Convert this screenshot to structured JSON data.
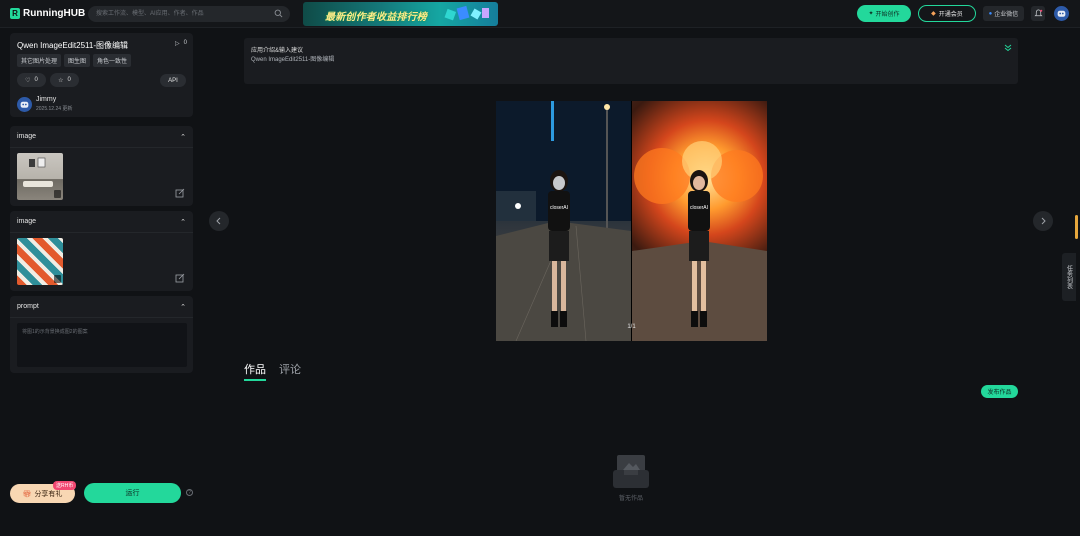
{
  "header": {
    "logo_mark": "R",
    "logo_text": "RunningHUB",
    "search_placeholder": "搜索工作流、模型、AI应用、作者、作品",
    "banner_text": "最新创作者收益排行榜",
    "create_label": "开始创作",
    "member_label": "开通会员",
    "enterprise_label": "企业微信"
  },
  "info": {
    "title": "Qwen ImageEdit2511-图像编辑",
    "runs": "0",
    "tags": [
      "其它图片处理",
      "图生图",
      "角色一致性"
    ],
    "likes": "0",
    "favorites": "0",
    "api_label": "API",
    "author": "Jimmy",
    "date": "2025.12.24 更新"
  },
  "inputs": {
    "image1_label": "image",
    "image2_label": "image",
    "prompt_label": "prompt",
    "prompt_placeholder": "将图1的示背景换成图2的图案"
  },
  "actions": {
    "share_label": "分享有礼",
    "share_badge": "送RH币",
    "run_label": "运行",
    "help": "?"
  },
  "intro": {
    "title": "应用介绍&输入建议",
    "subtitle": "Qwen ImageEdit2511-图像编辑"
  },
  "viewer": {
    "caption": "1/1",
    "shirt_text": "closerAI"
  },
  "tabs": [
    "作品",
    "评论"
  ],
  "works": {
    "publish_label": "发布作品",
    "empty_text": "暂无作品"
  },
  "side_tab_label": "任务列表",
  "colors": {
    "accent": "#23d89b",
    "background": "#101215",
    "panel": "#1a1c20"
  }
}
